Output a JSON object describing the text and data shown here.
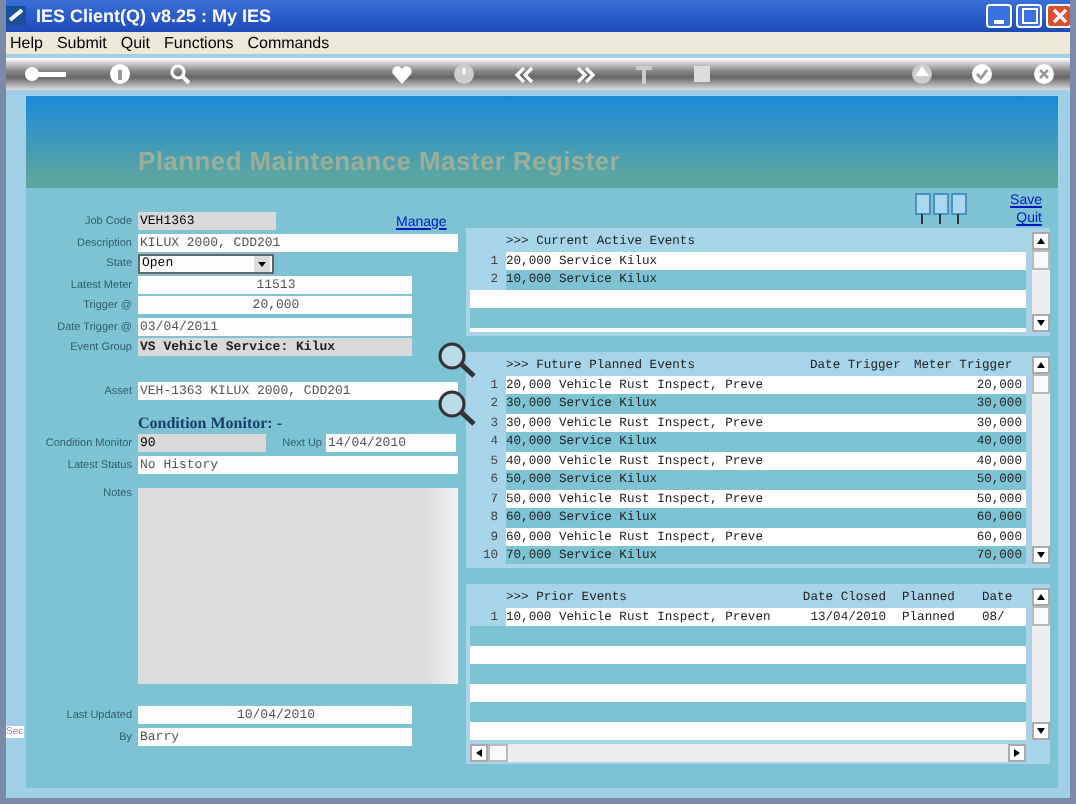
{
  "window": {
    "title": "IES Client(Q) v8.25 : My IES"
  },
  "menu": [
    "Help",
    "Submit",
    "Quit",
    "Functions",
    "Commands"
  ],
  "banner": {
    "title": "Planned Maintenance Master Register"
  },
  "links": {
    "manage": "Manage",
    "save": "Save",
    "quit": "Quit"
  },
  "side_tab": {
    "label": "Sec"
  },
  "form": {
    "job_code": {
      "label": "Job Code",
      "value": "VEH1363"
    },
    "description": {
      "label": "Description",
      "value": "KILUX 2000, CDD201"
    },
    "state": {
      "label": "State",
      "value": "Open"
    },
    "latest_meter": {
      "label": "Latest Meter",
      "value": "11513"
    },
    "trigger": {
      "label": "Trigger @",
      "value": "20,000"
    },
    "date_trigger": {
      "label": "Date Trigger @",
      "value": "03/04/2011"
    },
    "event_group": {
      "label": "Event Group",
      "value": "VS Vehicle Service: Kilux"
    },
    "asset": {
      "label": "Asset",
      "value": "VEH-1363 KILUX 2000, CDD201"
    },
    "condition_heading": "Condition Monitor: -",
    "condition_monitor": {
      "label": "Condition Monitor",
      "value": "90"
    },
    "next_up": {
      "label": "Next Up",
      "value": "14/04/2010"
    },
    "latest_status": {
      "label": "Latest Status",
      "value": "No History"
    },
    "notes": {
      "label": "Notes"
    },
    "last_updated": {
      "label": "Last Updated",
      "value": "10/04/2010"
    },
    "by": {
      "label": "By",
      "value": "Barry"
    }
  },
  "current_events": {
    "title": ">>> Current Active Events",
    "rows": [
      {
        "num": "1",
        "event": "20,000 Service Kilux"
      },
      {
        "num": "2",
        "event": "10,000 Service Kilux"
      }
    ]
  },
  "future_events": {
    "title": ">>> Future Planned Events",
    "columns": [
      "Date Trigger",
      "Meter Trigger"
    ],
    "rows": [
      {
        "num": "1",
        "event": "20,000 Vehicle Rust Inspect, Preve",
        "meter": "20,000"
      },
      {
        "num": "2",
        "event": "30,000 Service Kilux",
        "meter": "30,000"
      },
      {
        "num": "3",
        "event": "30,000 Vehicle Rust Inspect, Preve",
        "meter": "30,000"
      },
      {
        "num": "4",
        "event": "40,000 Service Kilux",
        "meter": "40,000"
      },
      {
        "num": "5",
        "event": "40,000 Vehicle Rust Inspect, Preve",
        "meter": "40,000"
      },
      {
        "num": "6",
        "event": "50,000 Service Kilux",
        "meter": "50,000"
      },
      {
        "num": "7",
        "event": "50,000 Vehicle Rust Inspect, Preve",
        "meter": "50,000"
      },
      {
        "num": "8",
        "event": "60,000 Service Kilux",
        "meter": "60,000"
      },
      {
        "num": "9",
        "event": "60,000 Vehicle Rust Inspect, Preve",
        "meter": "60,000"
      },
      {
        "num": "10",
        "event": "70,000 Service Kilux",
        "meter": "70,000"
      }
    ]
  },
  "prior_events": {
    "title": ">>> Prior Events",
    "columns": [
      "Date Closed",
      "Planned",
      "Date"
    ],
    "rows": [
      {
        "num": "1",
        "event": "10,000 Vehicle Rust Inspect, Preven",
        "date_closed": "13/04/2010",
        "planned": "Planned",
        "date": "08/"
      }
    ]
  }
}
